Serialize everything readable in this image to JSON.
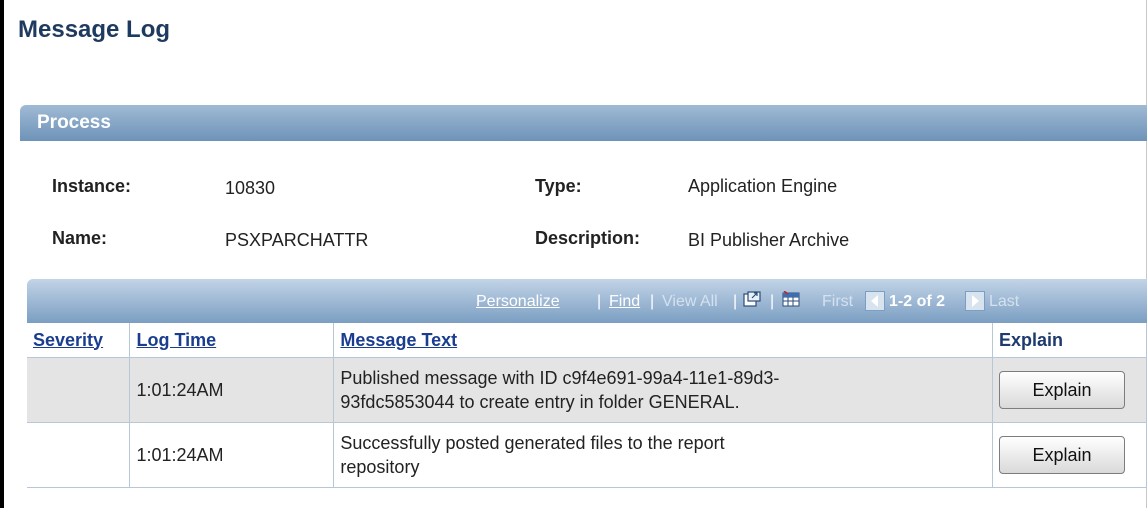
{
  "page": {
    "title": "Message Log"
  },
  "process": {
    "section_title": "Process",
    "instance_label": "Instance:",
    "instance_value": "10830",
    "type_label": "Type:",
    "type_value": "Application Engine",
    "name_label": "Name:",
    "name_value": "PSXPARCHATTR",
    "description_label": "Description:",
    "description_value": "BI Publisher Archive"
  },
  "grid": {
    "toolbar": {
      "personalize": "Personalize",
      "find": "Find",
      "view_all": "View All",
      "sep": "|",
      "first": "First",
      "range": "1-2 of 2",
      "last": "Last"
    },
    "columns": {
      "severity": "Severity",
      "log_time": "Log Time",
      "message_text": "Message Text",
      "explain": "Explain"
    },
    "rows": [
      {
        "severity": "",
        "log_time": "1:01:24AM",
        "message_line1": "Published message with ID c9f4e691-99a4-11e1-89d3-",
        "message_line2": "93fdc5853044 to create entry in folder GENERAL.",
        "button": "Explain"
      },
      {
        "severity": "",
        "log_time": "1:01:24AM",
        "message_line1": "Successfully posted generated files to the report",
        "message_line2": "repository",
        "button": "Explain"
      }
    ]
  },
  "icons": [
    "new-window-icon",
    "download-to-excel-icon",
    "previous-arrow-icon",
    "next-arrow-icon"
  ],
  "colors": {
    "title": "#1f3a5f",
    "section_header": "#7b9ec2",
    "row_alt": "#e4e4e4",
    "link": "#1a3d8f"
  }
}
